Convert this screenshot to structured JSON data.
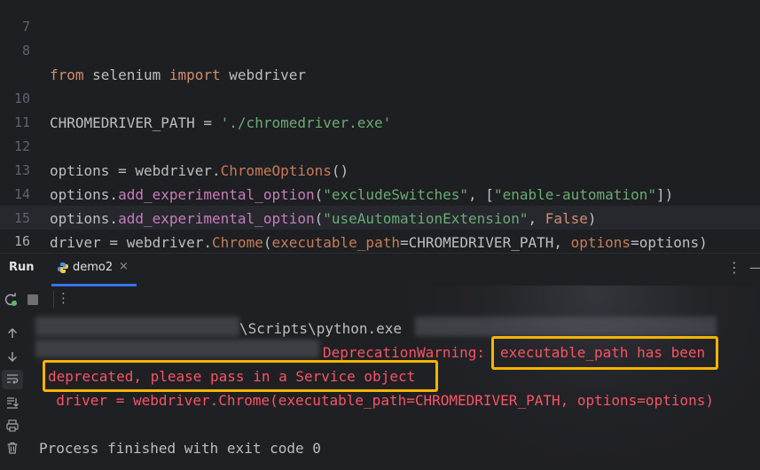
{
  "editor": {
    "lines": [
      {
        "num": "7"
      },
      {
        "num": "8"
      },
      {
        "num": "10"
      },
      {
        "num": "11"
      },
      {
        "num": "12"
      },
      {
        "num": "13"
      },
      {
        "num": "14"
      },
      {
        "num": "15"
      },
      {
        "num": "16"
      }
    ],
    "code": {
      "l8_from": "from",
      "l8_mod": " selenium ",
      "l8_import": "import",
      "l8_name": " webdriver",
      "l10_var": "CHROMEDRIVER_PATH = ",
      "l10_str": "'./chromedriver.exe'",
      "l12_a": "options = webdriver.",
      "l12_fn": "ChromeOptions",
      "l12_b": "()",
      "l13_a": "options.",
      "l13_fn": "add_experimental_option",
      "l13_b": "(",
      "l13_s1": "\"excludeSwitches\"",
      "l13_c": ", [",
      "l13_s2": "\"enable-automation\"",
      "l13_d": "])",
      "l14_a": "options.",
      "l14_fn": "add_experimental_option",
      "l14_b": "(",
      "l14_s1": "\"useAutomationExtension\"",
      "l14_c": ", ",
      "l14_kw": "False",
      "l14_d": ")",
      "l15_a": "driver = webdriver.",
      "l15_fn": "Chrome",
      "l15_b": "(",
      "l15_p1": "executable_path",
      "l15_c": "=CHROMEDRIVER_PATH, ",
      "l15_p2": "options",
      "l15_d": "=options)"
    }
  },
  "run_panel": {
    "title": "Run",
    "tab_label": "demo2",
    "tab_close": "×",
    "menu_icon": "⋮",
    "minimize_icon": "—"
  },
  "console": {
    "path_fragment": "\\Scripts\\python.exe",
    "warning_label": "DeprecationWarning: ",
    "warning_part1": "executable_path has been",
    "warning_part2": "deprecated, please pass in a Service object",
    "source_line": "  driver = webdriver.Chrome(executable_path=CHROMEDRIVER_PATH, options=options)",
    "exit_message": "Process finished with exit code 0"
  },
  "colors": {
    "error": "#f75464",
    "highlight": "#f4b400",
    "tab_underline": "#3574f0"
  }
}
